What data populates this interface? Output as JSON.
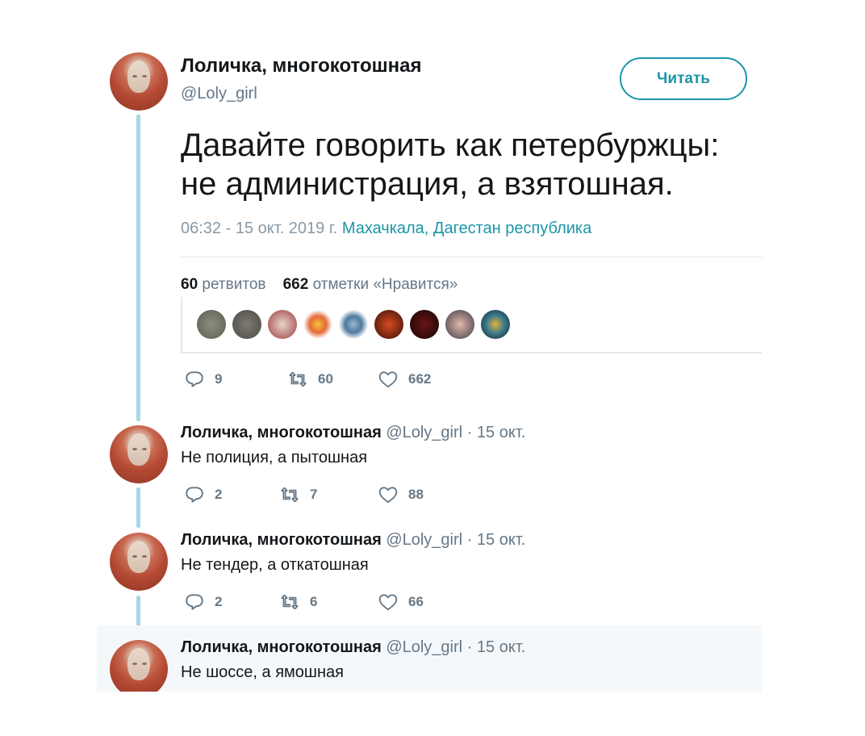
{
  "tweet": {
    "author_name": "Лоличка, многокотошная",
    "author_handle": "@Loly_girl",
    "follow_label": "Читать",
    "text_line1": "Давайте говорить как петербуржцы:",
    "text_line2": "не администрация, а взятошная.",
    "timestamp": "06:32 - 15 окт. 2019 г.",
    "location": "Махачкала, Дагестан республика",
    "retweets_count": "60",
    "retweets_label": "ретвитов",
    "likes_count": "662",
    "likes_label": "отметки «Нравится»",
    "actions": {
      "replies": "9",
      "retweets": "60",
      "likes": "662"
    }
  },
  "replies": [
    {
      "name": "Лоличка, многокотошная",
      "handle": "@Loly_girl",
      "sep": "·",
      "date": "15 окт.",
      "text": "Не полиция, а пытошная",
      "replies": "2",
      "retweets": "7",
      "likes": "88"
    },
    {
      "name": "Лоличка, многокотошная",
      "handle": "@Loly_girl",
      "sep": "·",
      "date": "15 окт.",
      "text": "Не тендер, а откатошная",
      "replies": "2",
      "retweets": "6",
      "likes": "66"
    },
    {
      "name": "Лоличка, многокотошная",
      "handle": "@Loly_girl",
      "sep": "·",
      "date": "15 окт.",
      "text": "Не шоссе, а ямошная"
    }
  ],
  "likers_icons": [
    "avatar-icon",
    "avatar-icon",
    "avatar-icon",
    "avatar-icon",
    "avatar-icon",
    "avatar-icon",
    "avatar-icon",
    "avatar-icon",
    "avatar-icon"
  ],
  "colors": {
    "accent": "#1b95a8",
    "thread_line": "#a9d6e5",
    "muted": "#657786"
  }
}
